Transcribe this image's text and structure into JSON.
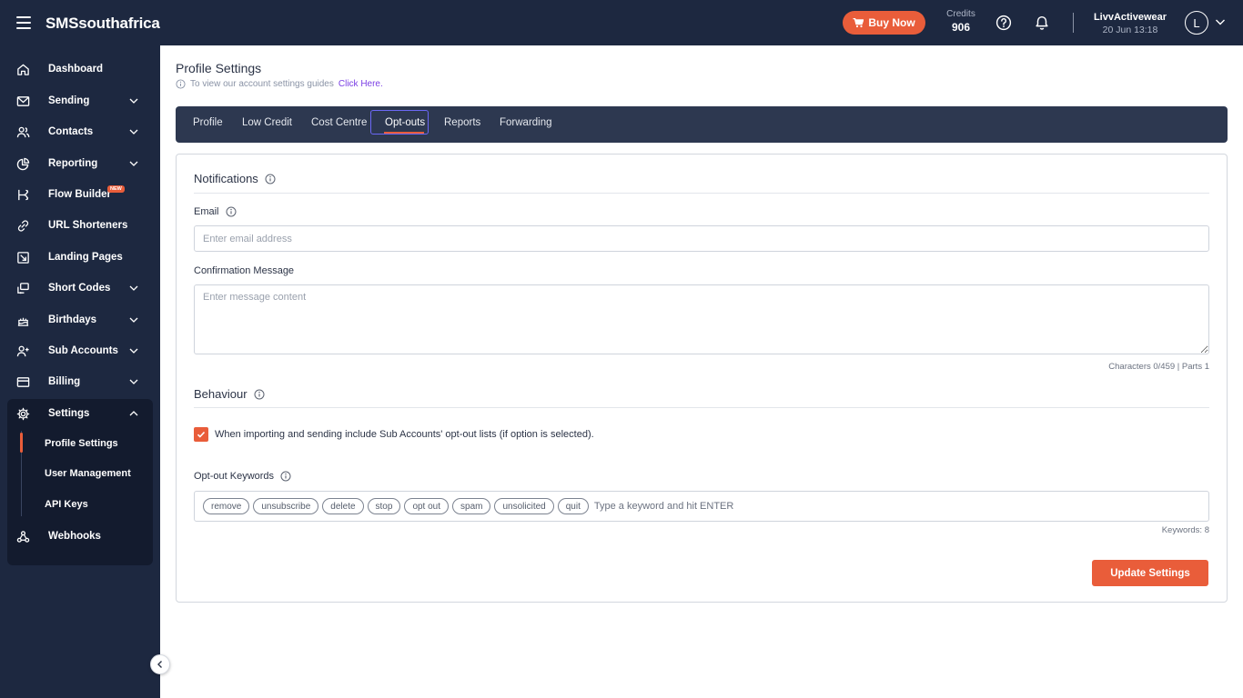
{
  "header": {
    "brand": "SMSsouthafrica",
    "buy_now": "Buy Now",
    "credits_label": "Credits",
    "credits_value": "906",
    "user_name": "LivvActivewear",
    "datetime": "20 Jun 13:18",
    "avatar_letter": "L"
  },
  "sidebar": {
    "items": [
      {
        "label": "Dashboard",
        "icon": "home-icon"
      },
      {
        "label": "Sending",
        "icon": "envelope-icon"
      },
      {
        "label": "Contacts",
        "icon": "users-icon"
      },
      {
        "label": "Reporting",
        "icon": "pie-chart-icon"
      },
      {
        "label": "Flow Builder",
        "icon": "flow-icon",
        "badge": "NEW"
      },
      {
        "label": "URL Shorteners",
        "icon": "link-icon"
      },
      {
        "label": "Landing Pages",
        "icon": "landing-page-icon"
      },
      {
        "label": "Short Codes",
        "icon": "short-code-icon"
      },
      {
        "label": "Birthdays",
        "icon": "cake-icon"
      },
      {
        "label": "Sub Accounts",
        "icon": "user-plus-icon"
      },
      {
        "label": "Billing",
        "icon": "credit-card-icon"
      },
      {
        "label": "Settings",
        "icon": "gear-icon"
      },
      {
        "label": "Webhooks",
        "icon": "webhook-icon"
      }
    ],
    "settings_sub": [
      "Profile Settings",
      "User Management",
      "API Keys"
    ],
    "active_sub": "Profile Settings"
  },
  "page": {
    "title": "Profile Settings",
    "guide_text": "To view our account settings guides",
    "guide_link": "Click Here."
  },
  "tabs": [
    "Profile",
    "Low Credit",
    "Cost Centre",
    "Opt-outs",
    "Reports",
    "Forwarding"
  ],
  "active_tab": "Opt-outs",
  "notifications": {
    "title": "Notifications",
    "email_label": "Email",
    "email_placeholder": "Enter email address",
    "email_value": "",
    "message_label": "Confirmation Message",
    "message_placeholder": "Enter message content",
    "message_value": "",
    "char_count": "Characters 0/459 | Parts 1"
  },
  "behaviour": {
    "title": "Behaviour",
    "checkbox_label": "When importing and sending include Sub Accounts' opt-out lists (if option is selected).",
    "checkbox_checked": true,
    "keywords_label": "Opt-out Keywords",
    "keywords": [
      "remove",
      "unsubscribe",
      "delete",
      "stop",
      "opt out",
      "spam",
      "unsolicited",
      "quit"
    ],
    "keyword_placeholder": "Type a keyword and hit ENTER",
    "keyword_count": "Keywords: 8"
  },
  "actions": {
    "update": "Update Settings"
  },
  "colors": {
    "accent": "#e95d3a",
    "navy": "#1d2840",
    "tab_bar": "#2d3850",
    "link": "#7b3fe4"
  }
}
